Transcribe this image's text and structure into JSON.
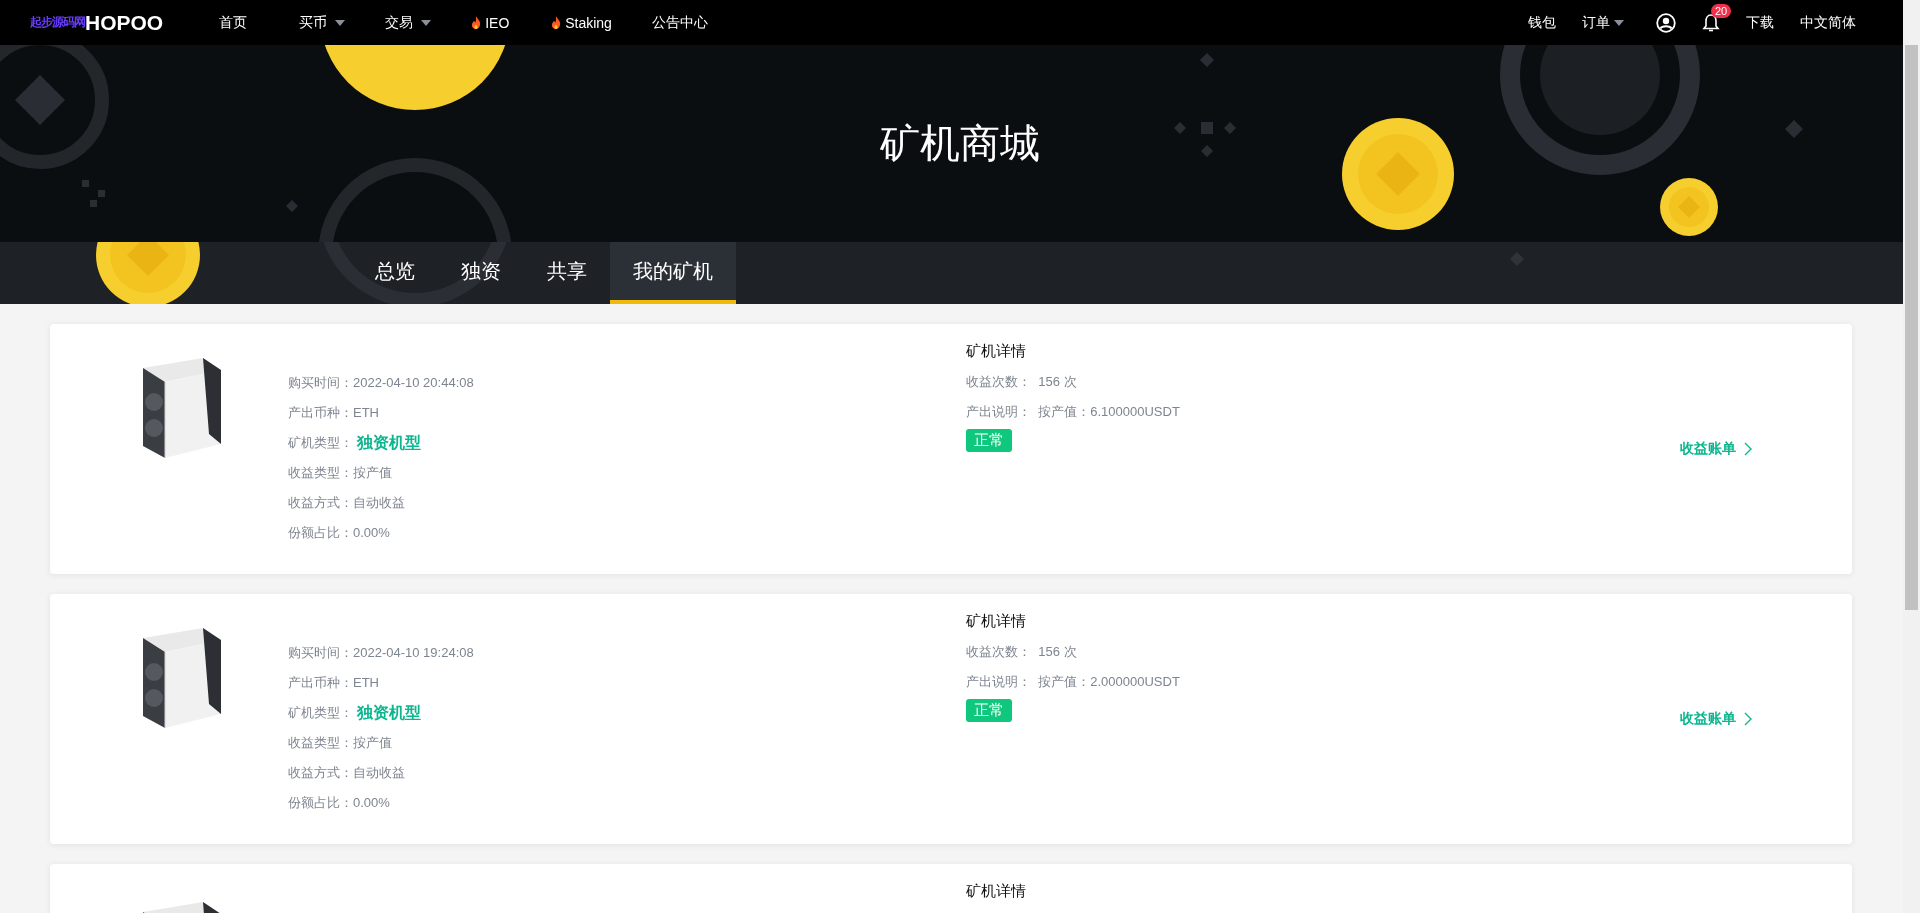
{
  "header": {
    "logo_mark": "起步源码网",
    "brand": "HOPOO",
    "nav": [
      {
        "label": "首页",
        "dropdown": false,
        "hot": false
      },
      {
        "label": "买币",
        "dropdown": true,
        "hot": false
      },
      {
        "label": "交易",
        "dropdown": true,
        "hot": false
      },
      {
        "label": "IEO",
        "dropdown": false,
        "hot": true
      },
      {
        "label": "Staking",
        "dropdown": false,
        "hot": true
      },
      {
        "label": "公告中心",
        "dropdown": false,
        "hot": false
      }
    ],
    "wallet": "钱包",
    "orders": "订单",
    "notification_count": "20",
    "download": "下载",
    "language": "中文简体"
  },
  "hero": {
    "title": "矿机商城"
  },
  "tabs": [
    {
      "label": "总览",
      "selected": false
    },
    {
      "label": "独资",
      "selected": false
    },
    {
      "label": "共享",
      "selected": false
    },
    {
      "label": "我的矿机",
      "selected": true
    }
  ],
  "cards": [
    {
      "info": [
        {
          "label": "购买时间：",
          "value": "2022-04-10 20:44:08",
          "kind": "plain"
        },
        {
          "label": "产出币种：",
          "value": "ETH",
          "kind": "plain"
        },
        {
          "label": "矿机类型：",
          "value": "独资机型",
          "kind": "highlight"
        },
        {
          "label": "收益类型：",
          "value": "按产值",
          "kind": "plain"
        },
        {
          "label": "收益方式：",
          "value": "自动收益",
          "kind": "plain"
        },
        {
          "label": "份额占比：",
          "value": "0.00%",
          "kind": "plain"
        }
      ],
      "details_title": "矿机详情",
      "details": [
        {
          "label": "收益次数：",
          "value": "156 次"
        },
        {
          "label": "产出说明：",
          "value": "按产值：6.100000USDT"
        }
      ],
      "status": "正常",
      "link": "收益账单"
    },
    {
      "info": [
        {
          "label": "购买时间：",
          "value": "2022-04-10 19:24:08",
          "kind": "plain"
        },
        {
          "label": "产出币种：",
          "value": "ETH",
          "kind": "plain"
        },
        {
          "label": "矿机类型：",
          "value": "独资机型",
          "kind": "highlight"
        },
        {
          "label": "收益类型：",
          "value": "按产值",
          "kind": "plain"
        },
        {
          "label": "收益方式：",
          "value": "自动收益",
          "kind": "plain"
        },
        {
          "label": "份额占比：",
          "value": "0.00%",
          "kind": "plain"
        }
      ],
      "details_title": "矿机详情",
      "details": [
        {
          "label": "收益次数：",
          "value": "156 次"
        },
        {
          "label": "产出说明：",
          "value": "按产值：2.000000USDT"
        }
      ],
      "status": "正常",
      "link": "收益账单"
    },
    {
      "details_title": "矿机详情"
    }
  ]
}
